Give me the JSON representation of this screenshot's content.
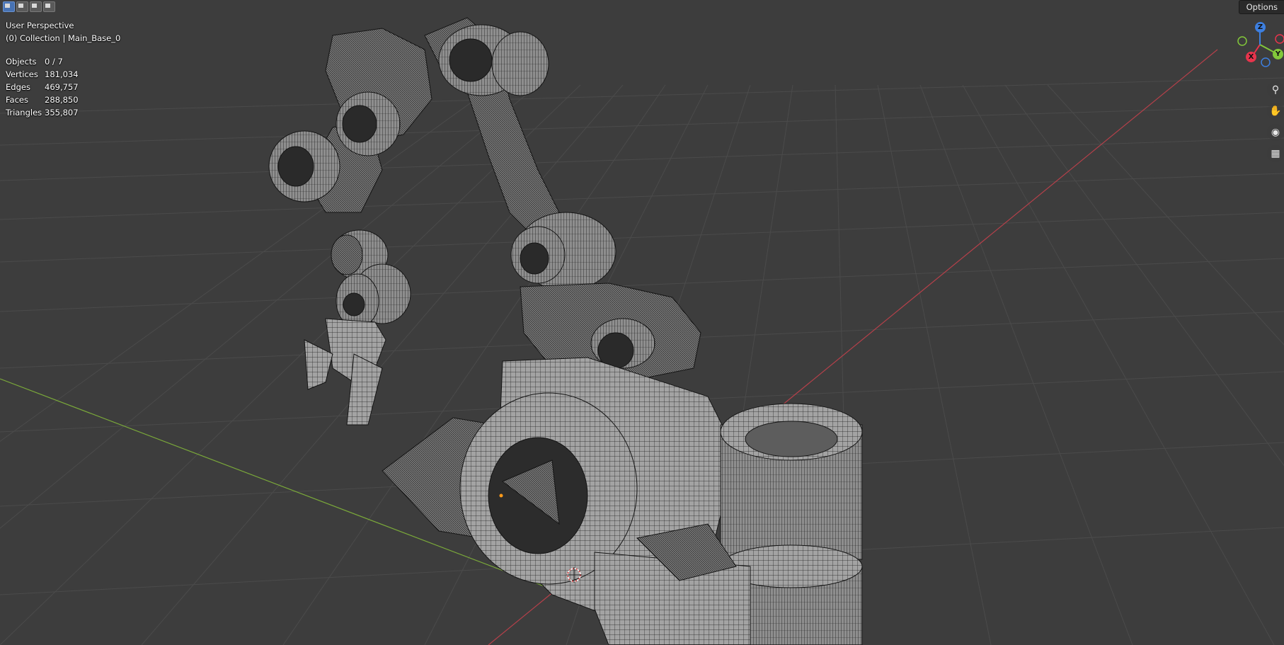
{
  "header": {
    "options_label": "Options"
  },
  "select_modes": [
    "set-selection-icon",
    "extend-selection-icon",
    "subtract-selection-icon",
    "intersect-selection-icon"
  ],
  "viewport": {
    "perspective": "User Perspective",
    "collection": "(0) Collection | Main_Base_0"
  },
  "stats": [
    {
      "label": "Objects",
      "value": "0 / 7"
    },
    {
      "label": "Vertices",
      "value": "181,034"
    },
    {
      "label": "Edges",
      "value": "469,757"
    },
    {
      "label": "Faces",
      "value": "288,850"
    },
    {
      "label": "Triangles",
      "value": "355,807"
    }
  ],
  "gizmo": {
    "x_label": "X",
    "y_label": "Y",
    "z_label": "Z",
    "x_color": "#e8344c",
    "y_color": "#82c83a",
    "z_color": "#3d7fe0"
  },
  "nav_icons": [
    "zoom-icon",
    "hand-pan-icon",
    "camera-icon",
    "grid-ortho-icon"
  ],
  "colors": {
    "background": "#3d3d3d",
    "grid": "#4a4a4a",
    "x_axis": "#b5404a",
    "y_axis": "#7aa83a",
    "mesh_fill": "#9e9e9e",
    "mesh_wire": "#1a1a1a"
  }
}
